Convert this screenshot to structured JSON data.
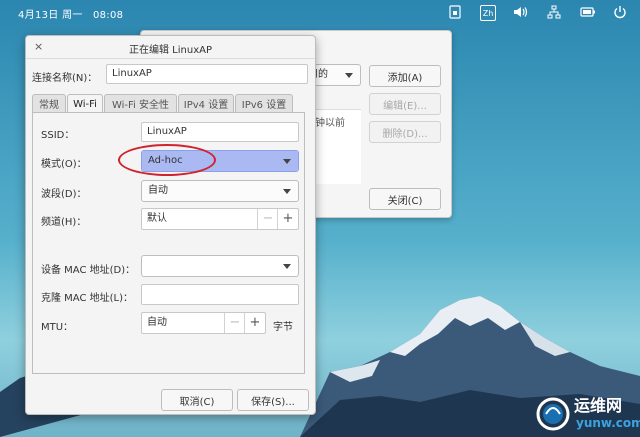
{
  "top_panel": {
    "clock": "4月13日 周一　08:08",
    "input_method": "Zh"
  },
  "background_window": {
    "filter_combo": "使用的",
    "list_text": "钟以前",
    "add_button": "添加(A)",
    "edit_button": "编辑(E)...",
    "delete_button": "删除(D)...",
    "close_button": "关闭(C)"
  },
  "dialog": {
    "title": "正在编辑 LinuxAP",
    "close_glyph": "×",
    "connection_name_label": "连接名称(N)：",
    "connection_name_value": "LinuxAP",
    "tabs": [
      "常规",
      "Wi-Fi",
      "Wi-Fi 安全性",
      "IPv4 设置",
      "IPv6 设置"
    ],
    "active_tab": "Wi-Fi",
    "ssid_label": "SSID：",
    "ssid_value": "LinuxAP",
    "mode_label": "模式(O)：",
    "mode_value": "Ad-hoc",
    "band_label": "波段(D)：",
    "band_value": "自动",
    "channel_label": "频道(H)：",
    "channel_value": "默认",
    "device_mac_label": "设备 MAC 地址(D)：",
    "device_mac_value": "",
    "cloned_mac_label": "克隆 MAC 地址(L)：",
    "cloned_mac_value": "",
    "mtu_label": "MTU：",
    "mtu_value": "自动",
    "mtu_unit": "字节",
    "minus": "−",
    "plus": "+",
    "cancel_button": "取消(C)",
    "save_button": "保存(S)..."
  },
  "watermark": {
    "text": "运维网",
    "subtext": "yunw.com"
  },
  "colors": {
    "selection_blue": "#aab9f2",
    "highlight_red": "#d0232d"
  }
}
